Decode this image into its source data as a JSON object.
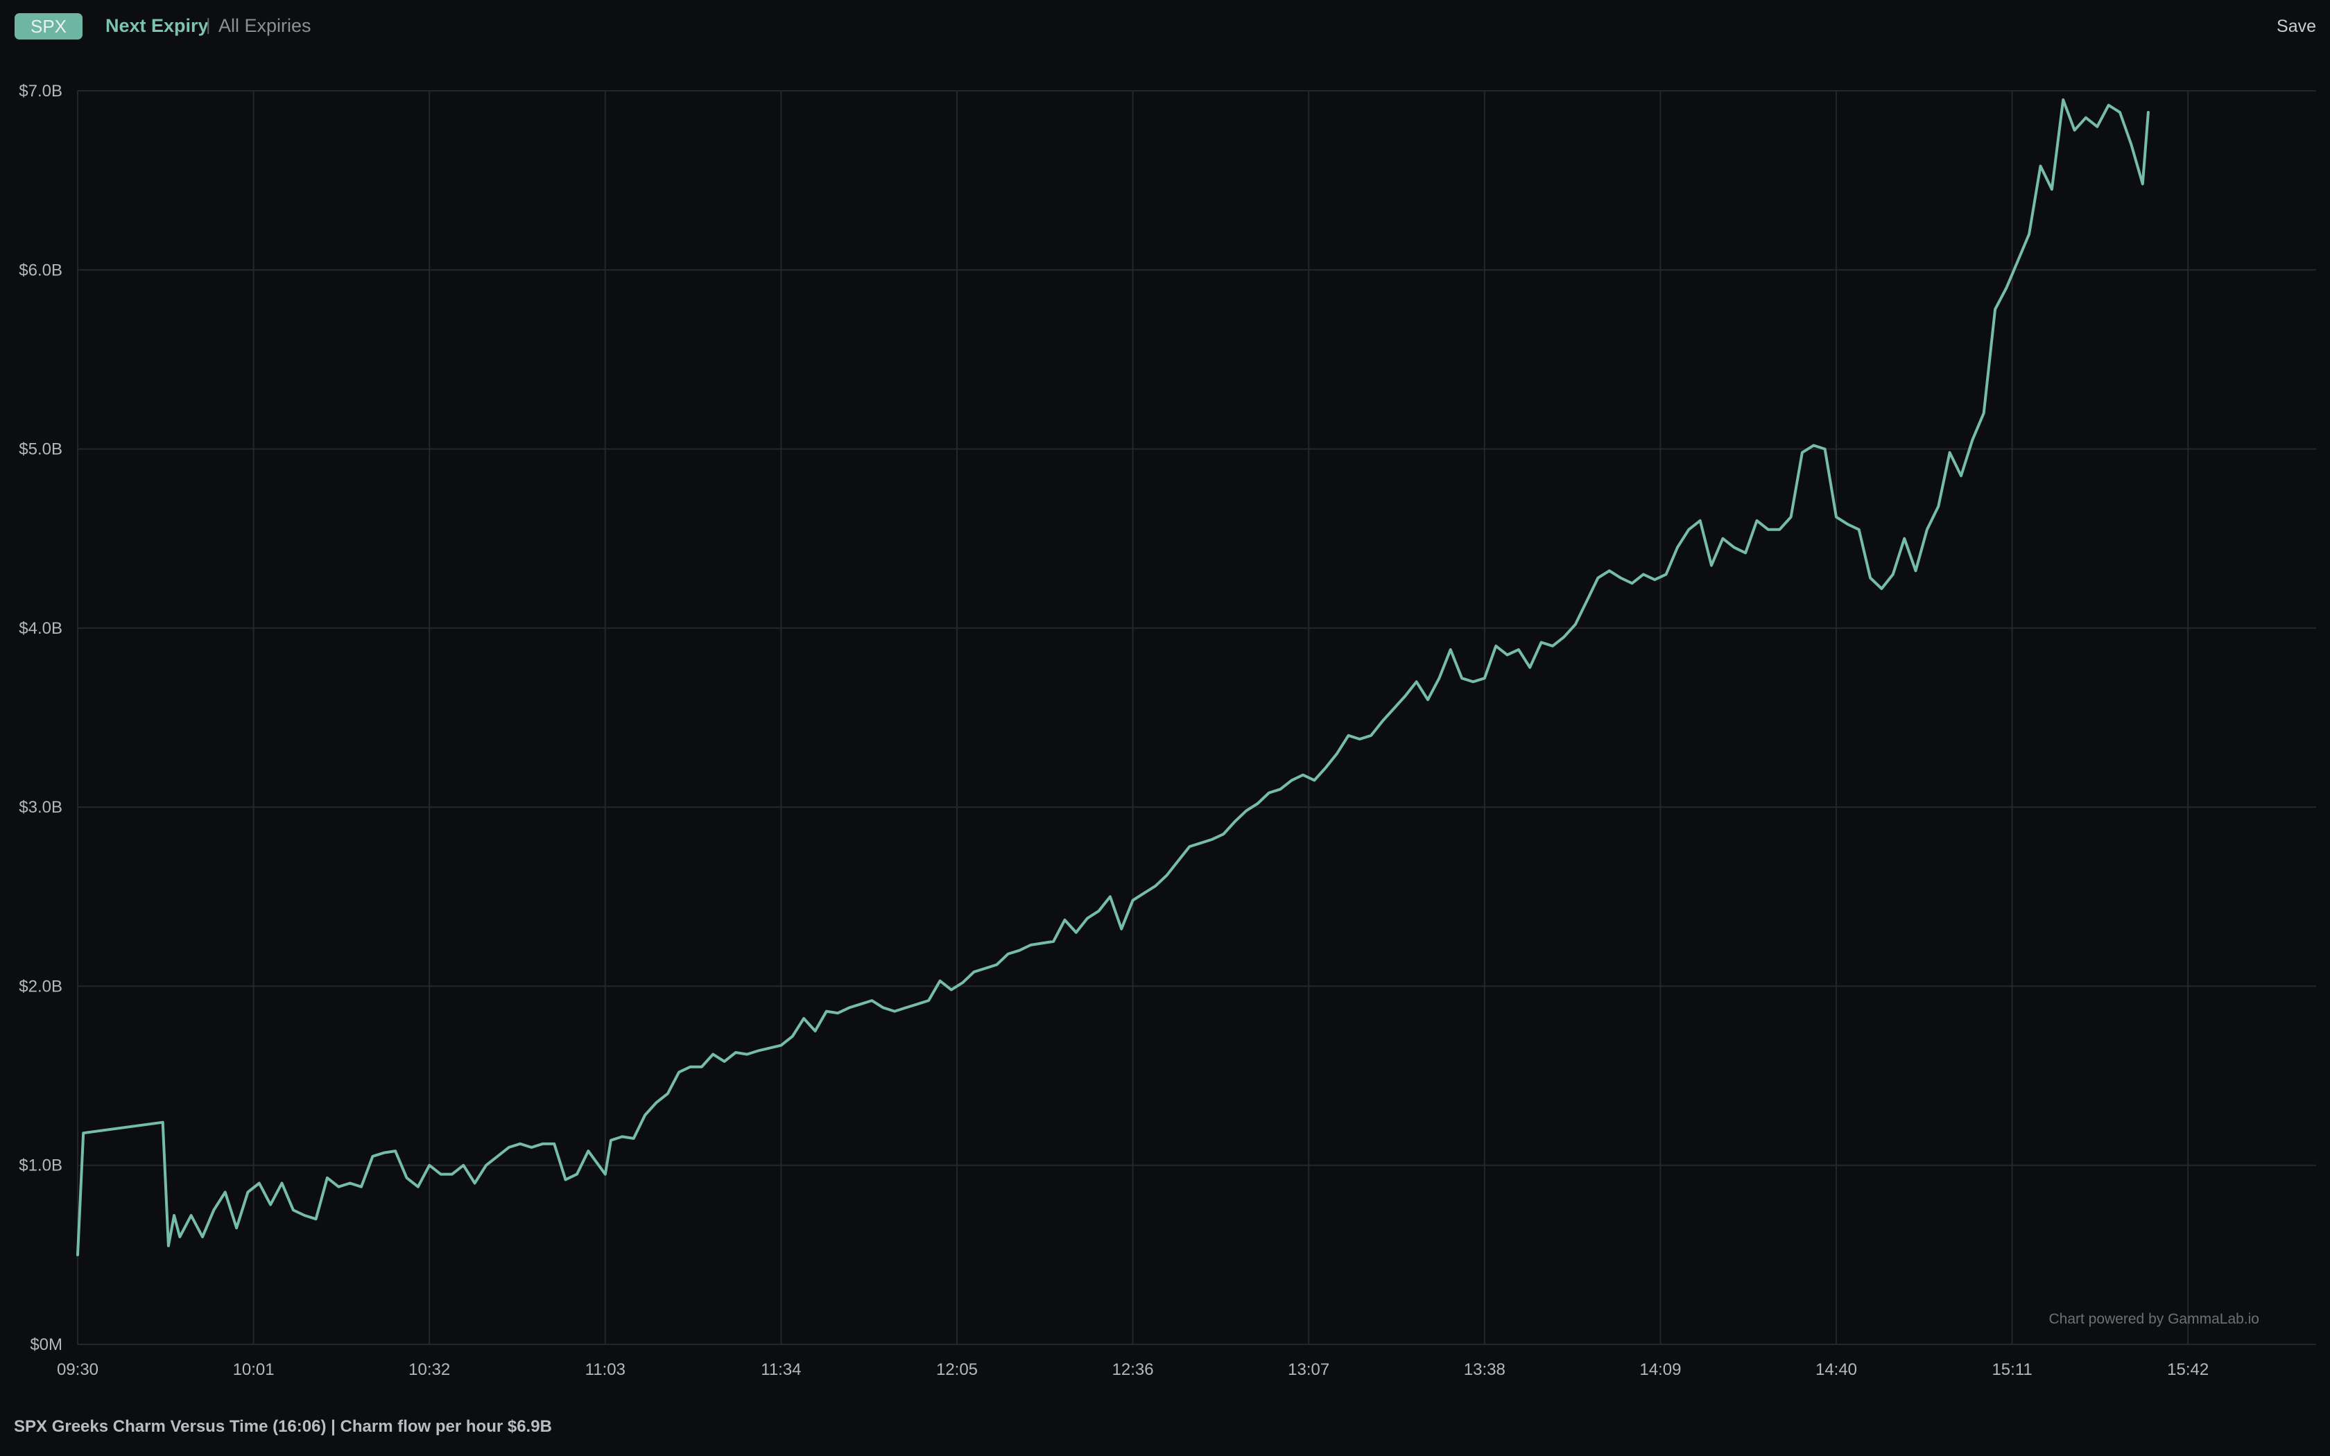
{
  "header": {
    "ticker": "SPX",
    "tab_next": "Next Expiry",
    "separator": "|",
    "tab_all": "All Expiries",
    "save_label": "Save"
  },
  "watermark": "Chart powered by GammaLab.io",
  "footer": {
    "text": "SPX Greeks Charm Versus Time (16:06) | Charm flow per hour $6.9B"
  },
  "colors": {
    "background": "#0c0d0f",
    "line": "#76bcaa",
    "grid": "#24262a",
    "badge": "#6fb5a3",
    "accent": "#7cc3b0"
  },
  "chart_data": {
    "type": "line",
    "title": "",
    "xlabel": "",
    "ylabel": "",
    "x_ticks": [
      "09:30",
      "10:01",
      "10:32",
      "11:03",
      "11:34",
      "12:05",
      "12:36",
      "13:07",
      "13:38",
      "14:09",
      "14:40",
      "15:11",
      "15:42"
    ],
    "y_ticks": [
      "$0M",
      "$1.0B",
      "$2.0B",
      "$3.0B",
      "$4.0B",
      "$5.0B",
      "$6.0B",
      "$7.0B"
    ],
    "ylim": [
      0,
      7.0
    ],
    "y_unit": "billions USD",
    "grid": true,
    "series": [
      {
        "points": [
          [
            "09:30",
            0.5
          ],
          [
            "09:31",
            1.18
          ],
          [
            "09:45",
            1.24
          ],
          [
            "09:46",
            0.55
          ],
          [
            "09:47",
            0.72
          ],
          [
            "09:48",
            0.6
          ],
          [
            "09:50",
            0.72
          ],
          [
            "09:52",
            0.6
          ],
          [
            "09:54",
            0.75
          ],
          [
            "09:56",
            0.85
          ],
          [
            "09:58",
            0.65
          ],
          [
            "10:00",
            0.85
          ],
          [
            "10:02",
            0.9
          ],
          [
            "10:04",
            0.78
          ],
          [
            "10:06",
            0.9
          ],
          [
            "10:08",
            0.75
          ],
          [
            "10:10",
            0.72
          ],
          [
            "10:12",
            0.7
          ],
          [
            "10:14",
            0.93
          ],
          [
            "10:16",
            0.88
          ],
          [
            "10:18",
            0.9
          ],
          [
            "10:20",
            0.88
          ],
          [
            "10:22",
            1.05
          ],
          [
            "10:24",
            1.07
          ],
          [
            "10:26",
            1.08
          ],
          [
            "10:28",
            0.93
          ],
          [
            "10:30",
            0.88
          ],
          [
            "10:32",
            1.0
          ],
          [
            "10:34",
            0.95
          ],
          [
            "10:36",
            0.95
          ],
          [
            "10:38",
            1.0
          ],
          [
            "10:40",
            0.9
          ],
          [
            "10:42",
            1.0
          ],
          [
            "10:44",
            1.05
          ],
          [
            "10:46",
            1.1
          ],
          [
            "10:48",
            1.12
          ],
          [
            "10:50",
            1.1
          ],
          [
            "10:52",
            1.12
          ],
          [
            "10:54",
            1.12
          ],
          [
            "10:56",
            0.92
          ],
          [
            "10:58",
            0.95
          ],
          [
            "11:00",
            1.08
          ],
          [
            "11:03",
            0.95
          ],
          [
            "11:04",
            1.14
          ],
          [
            "11:06",
            1.16
          ],
          [
            "11:08",
            1.15
          ],
          [
            "11:10",
            1.28
          ],
          [
            "11:12",
            1.35
          ],
          [
            "11:14",
            1.4
          ],
          [
            "11:16",
            1.52
          ],
          [
            "11:18",
            1.55
          ],
          [
            "11:20",
            1.55
          ],
          [
            "11:22",
            1.62
          ],
          [
            "11:24",
            1.58
          ],
          [
            "11:26",
            1.63
          ],
          [
            "11:28",
            1.62
          ],
          [
            "11:30",
            1.64
          ],
          [
            "11:34",
            1.67
          ],
          [
            "11:36",
            1.72
          ],
          [
            "11:38",
            1.82
          ],
          [
            "11:40",
            1.75
          ],
          [
            "11:42",
            1.86
          ],
          [
            "11:44",
            1.85
          ],
          [
            "11:46",
            1.88
          ],
          [
            "11:48",
            1.9
          ],
          [
            "11:50",
            1.92
          ],
          [
            "11:52",
            1.88
          ],
          [
            "11:54",
            1.86
          ],
          [
            "11:56",
            1.88
          ],
          [
            "11:58",
            1.9
          ],
          [
            "12:00",
            1.92
          ],
          [
            "12:02",
            2.03
          ],
          [
            "12:04",
            1.98
          ],
          [
            "12:06",
            2.02
          ],
          [
            "12:08",
            2.08
          ],
          [
            "12:10",
            2.1
          ],
          [
            "12:12",
            2.12
          ],
          [
            "12:14",
            2.18
          ],
          [
            "12:16",
            2.2
          ],
          [
            "12:18",
            2.23
          ],
          [
            "12:20",
            2.24
          ],
          [
            "12:22",
            2.25
          ],
          [
            "12:24",
            2.37
          ],
          [
            "12:26",
            2.3
          ],
          [
            "12:28",
            2.38
          ],
          [
            "12:30",
            2.42
          ],
          [
            "12:32",
            2.5
          ],
          [
            "12:34",
            2.32
          ],
          [
            "12:36",
            2.48
          ],
          [
            "12:38",
            2.52
          ],
          [
            "12:40",
            2.56
          ],
          [
            "12:42",
            2.62
          ],
          [
            "12:44",
            2.7
          ],
          [
            "12:46",
            2.78
          ],
          [
            "12:48",
            2.8
          ],
          [
            "12:50",
            2.82
          ],
          [
            "12:52",
            2.85
          ],
          [
            "12:54",
            2.92
          ],
          [
            "12:56",
            2.98
          ],
          [
            "12:58",
            3.02
          ],
          [
            "13:00",
            3.08
          ],
          [
            "13:02",
            3.1
          ],
          [
            "13:04",
            3.15
          ],
          [
            "13:06",
            3.18
          ],
          [
            "13:08",
            3.15
          ],
          [
            "13:10",
            3.22
          ],
          [
            "13:12",
            3.3
          ],
          [
            "13:14",
            3.4
          ],
          [
            "13:16",
            3.38
          ],
          [
            "13:18",
            3.4
          ],
          [
            "13:20",
            3.48
          ],
          [
            "13:22",
            3.55
          ],
          [
            "13:24",
            3.62
          ],
          [
            "13:26",
            3.7
          ],
          [
            "13:28",
            3.6
          ],
          [
            "13:30",
            3.72
          ],
          [
            "13:32",
            3.88
          ],
          [
            "13:34",
            3.72
          ],
          [
            "13:36",
            3.7
          ],
          [
            "13:38",
            3.72
          ],
          [
            "13:40",
            3.9
          ],
          [
            "13:42",
            3.85
          ],
          [
            "13:44",
            3.88
          ],
          [
            "13:46",
            3.78
          ],
          [
            "13:48",
            3.92
          ],
          [
            "13:50",
            3.9
          ],
          [
            "13:52",
            3.95
          ],
          [
            "13:54",
            4.02
          ],
          [
            "13:56",
            4.15
          ],
          [
            "13:58",
            4.28
          ],
          [
            "14:00",
            4.32
          ],
          [
            "14:02",
            4.28
          ],
          [
            "14:04",
            4.25
          ],
          [
            "14:06",
            4.3
          ],
          [
            "14:08",
            4.27
          ],
          [
            "14:10",
            4.3
          ],
          [
            "14:12",
            4.45
          ],
          [
            "14:14",
            4.55
          ],
          [
            "14:16",
            4.6
          ],
          [
            "14:18",
            4.35
          ],
          [
            "14:20",
            4.5
          ],
          [
            "14:22",
            4.45
          ],
          [
            "14:24",
            4.42
          ],
          [
            "14:26",
            4.6
          ],
          [
            "14:28",
            4.55
          ],
          [
            "14:30",
            4.55
          ],
          [
            "14:32",
            4.62
          ],
          [
            "14:34",
            4.98
          ],
          [
            "14:36",
            5.02
          ],
          [
            "14:38",
            5.0
          ],
          [
            "14:40",
            4.62
          ],
          [
            "14:42",
            4.58
          ],
          [
            "14:44",
            4.55
          ],
          [
            "14:46",
            4.28
          ],
          [
            "14:48",
            4.22
          ],
          [
            "14:50",
            4.3
          ],
          [
            "14:52",
            4.5
          ],
          [
            "14:54",
            4.32
          ],
          [
            "14:56",
            4.55
          ],
          [
            "14:58",
            4.68
          ],
          [
            "15:00",
            4.98
          ],
          [
            "15:02",
            4.85
          ],
          [
            "15:04",
            5.05
          ],
          [
            "15:06",
            5.2
          ],
          [
            "15:08",
            5.78
          ],
          [
            "15:10",
            5.9
          ],
          [
            "15:12",
            6.05
          ],
          [
            "15:14",
            6.2
          ],
          [
            "15:16",
            6.58
          ],
          [
            "15:18",
            6.45
          ],
          [
            "15:20",
            6.95
          ],
          [
            "15:22",
            6.78
          ],
          [
            "15:24",
            6.85
          ],
          [
            "15:26",
            6.8
          ],
          [
            "15:28",
            6.92
          ],
          [
            "15:30",
            6.88
          ],
          [
            "15:32",
            6.7
          ],
          [
            "15:34",
            6.48
          ],
          [
            "15:35",
            6.88
          ]
        ]
      }
    ]
  }
}
